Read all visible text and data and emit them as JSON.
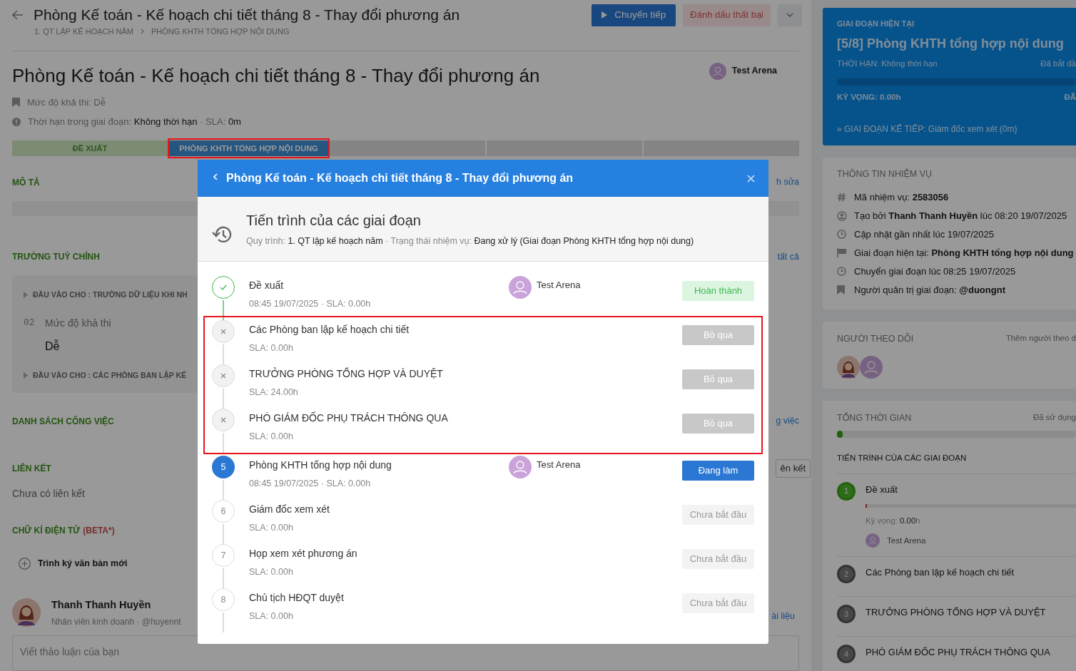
{
  "header": {
    "title": "Phòng Kế toán - Kế hoạch chi tiết tháng 8 - Thay đổi phương án",
    "breadcrumb": [
      "1. QT LẬP KẾ HOẠCH NĂM",
      "PHÒNG KHTH TỔNG HỢP NỘI DUNG"
    ],
    "forward_button": "Chuyển tiếp",
    "fail_button": "Đánh dấu thất bại"
  },
  "task": {
    "title": "Phòng Kế toán - Kế hoạch chi tiết tháng 8 - Thay đổi phương án",
    "assignee": "Test Arena",
    "meta": [
      {
        "kind": "bookmark",
        "parts": [
          {
            "text": "Mức độ khả thi: Dễ",
            "emphasis": false
          }
        ]
      },
      {
        "kind": "alert",
        "parts": [
          {
            "text": "Thời hạn trong giai đoạn:",
            "emphasis": false
          },
          {
            "text": "Không thời hạn",
            "emphasis": true
          },
          {
            "text": "· SLA:",
            "emphasis": false
          },
          {
            "text": "0m",
            "emphasis": true
          }
        ]
      }
    ]
  },
  "stage_bar": [
    {
      "label": "ĐỀ XUẤT",
      "kind": "done",
      "highlighted": false
    },
    {
      "label": "PHÒNG KHTH TỔNG HỢP NỘI DUNG",
      "kind": "current",
      "highlighted": true
    },
    {
      "kind": "pending",
      "highlighted": false
    },
    {
      "kind": "pending",
      "highlighted": false
    },
    {
      "kind": "pending",
      "highlighted": false
    }
  ],
  "description": {
    "heading": "MÔ TẢ",
    "edge_text": "h sửa"
  },
  "custom_fields": {
    "heading": "TRƯỜNG TUỲ CHỈNH",
    "edge_text": "tất cả",
    "groups": [
      {
        "title": "ĐẦU VÀO CHO : TRƯỜNG DỮ LIỆU KHI NH",
        "fields": [
          {
            "index": "02",
            "label": "Mức độ khả thi",
            "value": "Dễ"
          }
        ]
      },
      {
        "title": "ĐẦU VÀO CHO : CÁC PHÒNG BAN LẬP KẾ"
      }
    ]
  },
  "task_list": {
    "heading": "DANH SÁCH CÔNG VIỆC",
    "edge_text": "g việc"
  },
  "links": {
    "heading": "LIÊN KẾT",
    "empty_text": "Chưa có liên kết",
    "edge_button": "ên kết"
  },
  "signature": {
    "heading": "CHỮ KÍ ĐIỆN TỬ",
    "tag": "(BETA*)",
    "action": "Trình ký văn bản mới"
  },
  "comment": {
    "author": "Thanh Thanh Huyền",
    "subtitle": "Nhân viên kinh doanh · @huyennt",
    "edge_text": "ài liệu",
    "placeholder": "Viết thảo luận của bạn"
  },
  "current_stage": {
    "label": "GIAI ĐOẠN HIỆN TẠI",
    "title": "[5/8] Phòng KHTH tổng hợp nội dung",
    "deadline": "THỜI HẠN: Không thời hạn",
    "started": "Đã bắt đầ",
    "level": 0,
    "expected": "KỲ VỌNG: 0.00h",
    "used": "ĐÃ",
    "next": "» GIAI ĐOẠN KẾ TIẾP: Giám đốc xem xét (0m)"
  },
  "task_info": {
    "heading": "THÔNG TIN NHIỆM VỤ",
    "rows": [
      {
        "kind": "hash",
        "text": "Mã nhiệm vụ: **2583056**"
      },
      {
        "kind": "user",
        "text": "Tạo bởi **Thanh Thanh Huyền** lúc 08:20 19/07/2025"
      },
      {
        "kind": "clock",
        "text": "Cập nhật gần nhất lúc 19/07/2025"
      },
      {
        "kind": "flag",
        "text": "Giai đoạn hiện tại: **Phòng KHTH tổng hợp nội dung**"
      },
      {
        "kind": "clock",
        "text": "Chuyển giai đoạn lúc 08:25 19/07/2025"
      },
      {
        "kind": "bookmark",
        "text": "Người quản trị giai đoạn: **@duongnt**"
      }
    ]
  },
  "followers": {
    "heading": "NGƯỜI THEO DÕI",
    "action": "Thêm người theo d",
    "avatars": [
      {
        "kind": "illustrated"
      },
      {
        "kind": "placeholder"
      }
    ]
  },
  "total_time": {
    "heading": "TỔNG THỜI GIAN",
    "used": "Đã sử dụng",
    "level": 0.01,
    "subheading": "TIẾN TRÌNH CỦA CÁC GIAI ĐOẠN",
    "stages": [
      {
        "number": "1",
        "name": "Đề xuất",
        "kind": "done",
        "level": 0.005,
        "expected": "Kỳ vọng: **0.00**h",
        "assignee": "Test Arena"
      },
      {
        "number": "2",
        "name": "Các Phòng ban lập kế hoạch chi tiết",
        "kind": "pending"
      },
      {
        "number": "3",
        "name": "TRƯỞNG PHÒNG TỔNG HỢP VÀ DUYỆT",
        "kind": "pending"
      },
      {
        "number": "4",
        "name": "PHÓ GIÁM ĐỐC PHỤ TRÁCH THÔNG QUA",
        "kind": "pending"
      }
    ]
  },
  "modal": {
    "title": "Phòng Kế toán - Kế hoạch chi tiết tháng 8 - Thay đổi phương án",
    "heading": "Tiến trình của các giai đoạn",
    "process_label": "Quy trình:",
    "process": "1. QT lập kế hoạch năm",
    "status_label": "· Trạng thái nhiệm vụ:",
    "status": "Đang xử lý (Giai đoạn Phòng KHTH tổng hợp nội dung)",
    "stages": [
      {
        "kind": "done",
        "name": "Đề xuất",
        "meta": "08:45 19/07/2025 · SLA: 0.00h",
        "assignee": "Test Arena",
        "badge": "Hoàn thành",
        "highlighted": false
      },
      {
        "kind": "skipped",
        "name": "Các Phòng ban lập kế hoạch chi tiết",
        "meta": "SLA: 0.00h",
        "badge": "Bỏ qua",
        "highlighted": true
      },
      {
        "kind": "skipped",
        "name": "TRƯỞNG PHÒNG TỔNG HỢP VÀ DUYỆT",
        "meta": "SLA: 24.00h",
        "badge": "Bỏ qua",
        "highlighted": true
      },
      {
        "kind": "skipped",
        "name": "PHÓ GIÁM ĐỐC PHỤ TRÁCH THÔNG QUA",
        "meta": "SLA: 0.00h",
        "badge": "Bỏ qua",
        "highlighted": true
      },
      {
        "kind": "current",
        "number": "5",
        "name": "Phòng KHTH tổng hợp nội dung",
        "meta": "08:45 19/07/2025 · SLA: 0.00h",
        "assignee": "Test Arena",
        "badge": "Đang làm",
        "highlighted": false
      },
      {
        "kind": "pending",
        "number": "6",
        "name": "Giám đốc xem xét",
        "meta": "SLA: 0.00h",
        "badge": "Chưa bắt đầu",
        "highlighted": false
      },
      {
        "kind": "pending",
        "number": "7",
        "name": "Họp xem xét phương án",
        "meta": "SLA: 0.00h",
        "badge": "Chưa bắt đầu",
        "highlighted": false
      },
      {
        "kind": "pending",
        "number": "8",
        "name": "Chủ tịch HĐQT duyệt",
        "meta": "SLA: 0.00h",
        "badge": "Chưa bắt đầu",
        "highlighted": false
      }
    ]
  }
}
